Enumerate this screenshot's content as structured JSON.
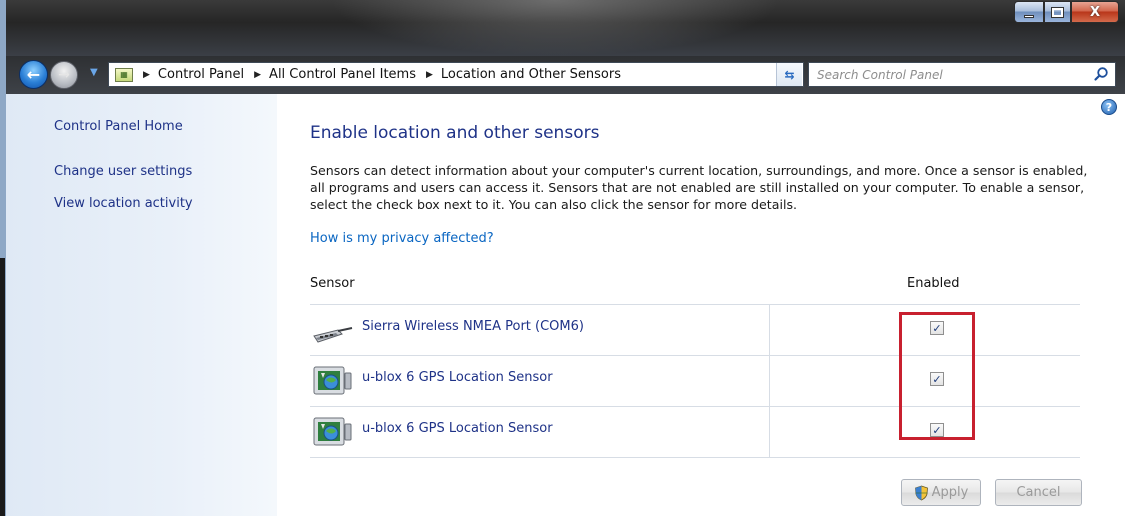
{
  "window": {
    "minimize_icon": "minimize-icon",
    "maximize_icon": "maximize-icon",
    "close_icon": "close-icon",
    "close_glyph": "X"
  },
  "nav": {
    "back_icon": "back-arrow-icon",
    "forward_icon": "forward-arrow-icon",
    "back_glyph": "←",
    "forward_glyph": "→",
    "breadcrumbs": [
      "Control Panel",
      "All Control Panel Items",
      "Location and Other Sensors"
    ],
    "search_placeholder": "Search Control Panel"
  },
  "sidebar": {
    "items": [
      {
        "label": "Control Panel Home"
      },
      {
        "label": "Change user settings"
      },
      {
        "label": "View location activity"
      }
    ]
  },
  "main": {
    "title": "Enable location and other sensors",
    "description": "Sensors can detect information about your computer's current location, surroundings, and more. Once a sensor is enabled, all programs and users can access it. Sensors that are not enabled are still installed on your computer. To enable a sensor, select the check box next to it. You can also click the sensor for more details.",
    "privacy_link": "How is my privacy affected?",
    "help_glyph": "?"
  },
  "table": {
    "headers": {
      "sensor": "Sensor",
      "enabled": "Enabled"
    },
    "rows": [
      {
        "name": "Sierra Wireless NMEA Port (COM6)",
        "icon": "serial-port-icon",
        "enabled": true
      },
      {
        "name": "u-blox 6 GPS Location Sensor",
        "icon": "gps-sensor-icon",
        "enabled": true
      },
      {
        "name": "u-blox 6 GPS Location Sensor",
        "icon": "gps-sensor-icon",
        "enabled": true
      }
    ]
  },
  "buttons": {
    "apply": "Apply",
    "cancel": "Cancel"
  },
  "colors": {
    "link": "#1e3287",
    "highlight": "#c8202f"
  }
}
